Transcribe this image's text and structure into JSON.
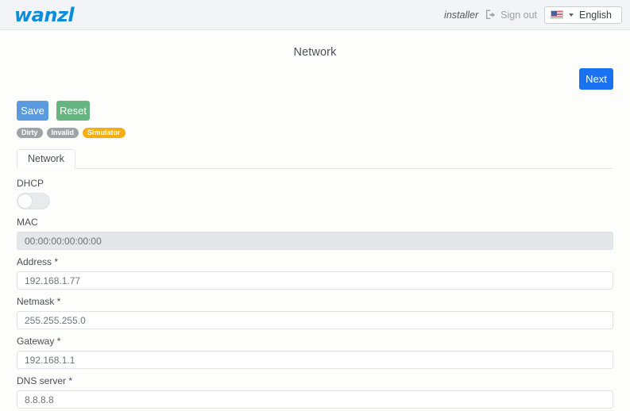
{
  "header": {
    "brand": "wanzl",
    "user": "installer",
    "signout_label": "Sign out",
    "signout_icon": "sign-out-icon",
    "language": {
      "flag_icon": "us-flag-icon",
      "caret_icon": "chevron-down-icon",
      "selected": "English",
      "options": [
        "English"
      ]
    }
  },
  "page": {
    "title": "Network"
  },
  "toolbar": {
    "next_label": "Next",
    "save_label": "Save",
    "reset_label": "Reset"
  },
  "badges": [
    {
      "label": "Dirty",
      "color": "#9ea3a8"
    },
    {
      "label": "Invalid",
      "color": "#9ea3a8"
    },
    {
      "label": "Simulator",
      "color": "#f5ad14"
    }
  ],
  "tabs": [
    {
      "label": "Network",
      "active": true
    }
  ],
  "form": {
    "dhcp": {
      "label": "DHCP",
      "value": "off"
    },
    "mac": {
      "label": "MAC",
      "value": "00:00:00:00:00:00",
      "disabled": true
    },
    "address": {
      "label": "Address *",
      "value": "192.168.1.77"
    },
    "netmask": {
      "label": "Netmask *",
      "value": "255.255.255.0"
    },
    "gateway": {
      "label": "Gateway *",
      "value": "192.168.1.1"
    },
    "dns": {
      "label": "DNS server *",
      "value": "8.8.8.8"
    }
  },
  "colors": {
    "brand_blue": "#0b8ddb",
    "next_blue": "#1b72f0",
    "save_blue": "#5a9ade",
    "reset_green": "#66b581",
    "badge_gray": "#9ea3a8",
    "badge_orange": "#f5ad14",
    "header_bg": "#f2f4f7",
    "page_bg": "#fdfdfc"
  }
}
